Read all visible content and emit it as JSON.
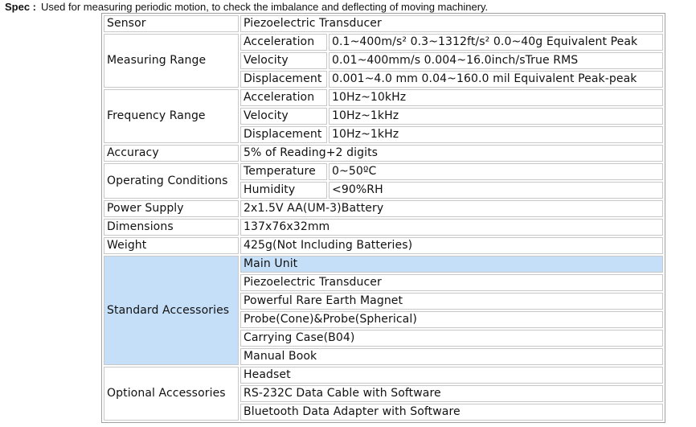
{
  "intro": {
    "label": "Spec :",
    "text": "Used for measuring periodic motion, to check the imbalance and deflecting of moving machinery."
  },
  "spec": {
    "sensor": {
      "label": "Sensor",
      "value": "Piezoelectric Transducer"
    },
    "measuring_range": {
      "label": "Measuring Range",
      "rows": [
        {
          "name": "Acceleration",
          "value": "0.1~400m/s² 0.3~1312ft/s² 0.0~40g Equivalent Peak"
        },
        {
          "name": "Velocity",
          "value": "0.01~400mm/s 0.004~16.0inch/sTrue RMS"
        },
        {
          "name": "Displacement",
          "value": "0.001~4.0 mm 0.04~160.0 mil Equivalent Peak-peak"
        }
      ]
    },
    "frequency_range": {
      "label": "Frequency Range",
      "rows": [
        {
          "name": "Acceleration",
          "value": "10Hz~10kHz"
        },
        {
          "name": "Velocity",
          "value": "10Hz~1kHz"
        },
        {
          "name": "Displacement",
          "value": "10Hz~1kHz"
        }
      ]
    },
    "accuracy": {
      "label": "Accuracy",
      "value": "5% of Reading+2 digits"
    },
    "operating_conditions": {
      "label": "Operating Conditions",
      "rows": [
        {
          "name": "Temperature",
          "value": "0~50ºC"
        },
        {
          "name": "Humidity",
          "value": "<90%RH"
        }
      ]
    },
    "power_supply": {
      "label": "Power Supply",
      "value": "2x1.5V AA(UM-3)Battery"
    },
    "dimensions": {
      "label": "Dimensions",
      "value": "137x76x32mm"
    },
    "weight": {
      "label": "Weight",
      "value": "425g(Not Including Batteries)"
    },
    "standard_accessories": {
      "label": "Standard Accessories",
      "items": [
        "Main Unit",
        "Piezoelectric Transducer",
        "Powerful Rare Earth Magnet",
        "Probe(Cone)&Probe(Spherical)",
        "Carrying Case(B04)",
        "Manual Book"
      ]
    },
    "optional_accessories": {
      "label": "Optional Accessories",
      "items": [
        "Headset",
        "RS-232C Data Cable with Software",
        "Bluetooth Data Adapter with Software"
      ]
    }
  },
  "colors": {
    "highlight": "#c5dff8",
    "border": "#c8c8c8",
    "outer_border": "#a0a0a0"
  }
}
